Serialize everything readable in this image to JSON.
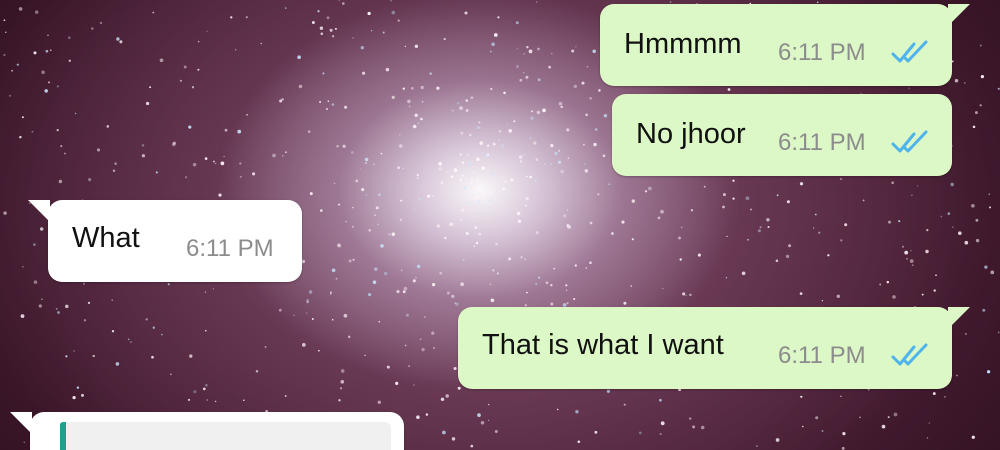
{
  "chat": {
    "messages": [
      {
        "text": "Hmmmm",
        "time": "6:11 PM",
        "direction": "outgoing",
        "status": "read"
      },
      {
        "text": "No jhoor",
        "time": "6:11 PM",
        "direction": "outgoing",
        "status": "read"
      },
      {
        "text": "What",
        "time": "6:11 PM",
        "direction": "incoming"
      },
      {
        "text": "That is what I want",
        "time": "6:11 PM",
        "direction": "outgoing",
        "status": "read"
      }
    ]
  },
  "colors": {
    "outgoing_bubble": "#dcf8c6",
    "incoming_bubble": "#ffffff",
    "read_ticks": "#4fb3ec",
    "timestamp": "#8c8c8c",
    "quote_bar": "#1fa08a"
  },
  "icons": {
    "read_receipt": "double-check-icon"
  }
}
